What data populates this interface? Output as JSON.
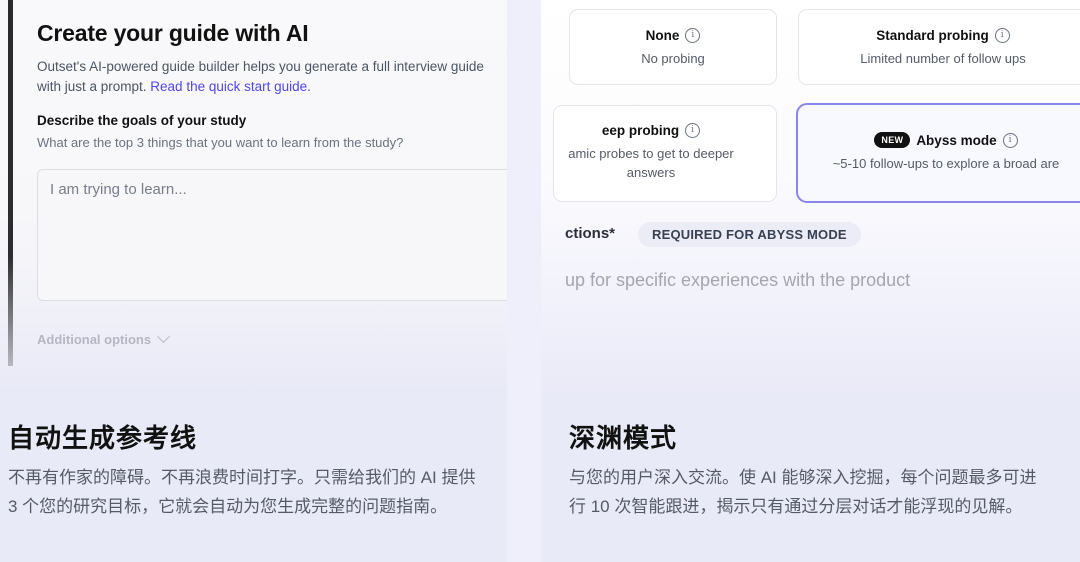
{
  "left_card": {
    "guide": {
      "title": "Create your guide with AI",
      "description": "Outset's AI-powered guide builder helps you generate a full interview guide with just a prompt. ",
      "link_text": "Read the quick start guide.",
      "goals_title": "Describe the goals of your study",
      "goals_subtitle": "What are the top 3 things that you want to learn from the study?",
      "goals_placeholder": "I am trying to learn...",
      "additional_options": "Additional options"
    },
    "feature_title": "自动生成参考线",
    "feature_description": "不再有作家的障碍。不再浪费时间打字。只需给我们的 AI 提供 3 个您的研究目标，它就会自动为您生成完整的问题指南。"
  },
  "right_card": {
    "options": [
      {
        "title": "None",
        "subtitle": "No probing"
      },
      {
        "title": "Standard probing",
        "subtitle": "Limited number of follow ups"
      },
      {
        "title": "eep probing",
        "subtitle": "amic probes to get to deeper answers"
      },
      {
        "badge": "NEW",
        "title": "Abyss mode",
        "subtitle": "~5-10 follow-ups to explore a broad are"
      }
    ],
    "info_glyph": "i",
    "instructions_label": "ctions*",
    "required_badge": "REQUIRED FOR ABYSS MODE",
    "instructions_placeholder": "up for specific experiences with the product",
    "feature_title": "深渊模式",
    "feature_description": "与您的用户深入交流。使 AI 能够深入挖掘，每个问题最多可进行 10 次智能跟进，揭示只有通过分层对话才能浮现的见解。"
  },
  "colors": {
    "page_bg": "#eeeffa",
    "accent_link": "#4f46e5",
    "selected_border": "#8b86ec",
    "badge_bg": "#111111"
  }
}
